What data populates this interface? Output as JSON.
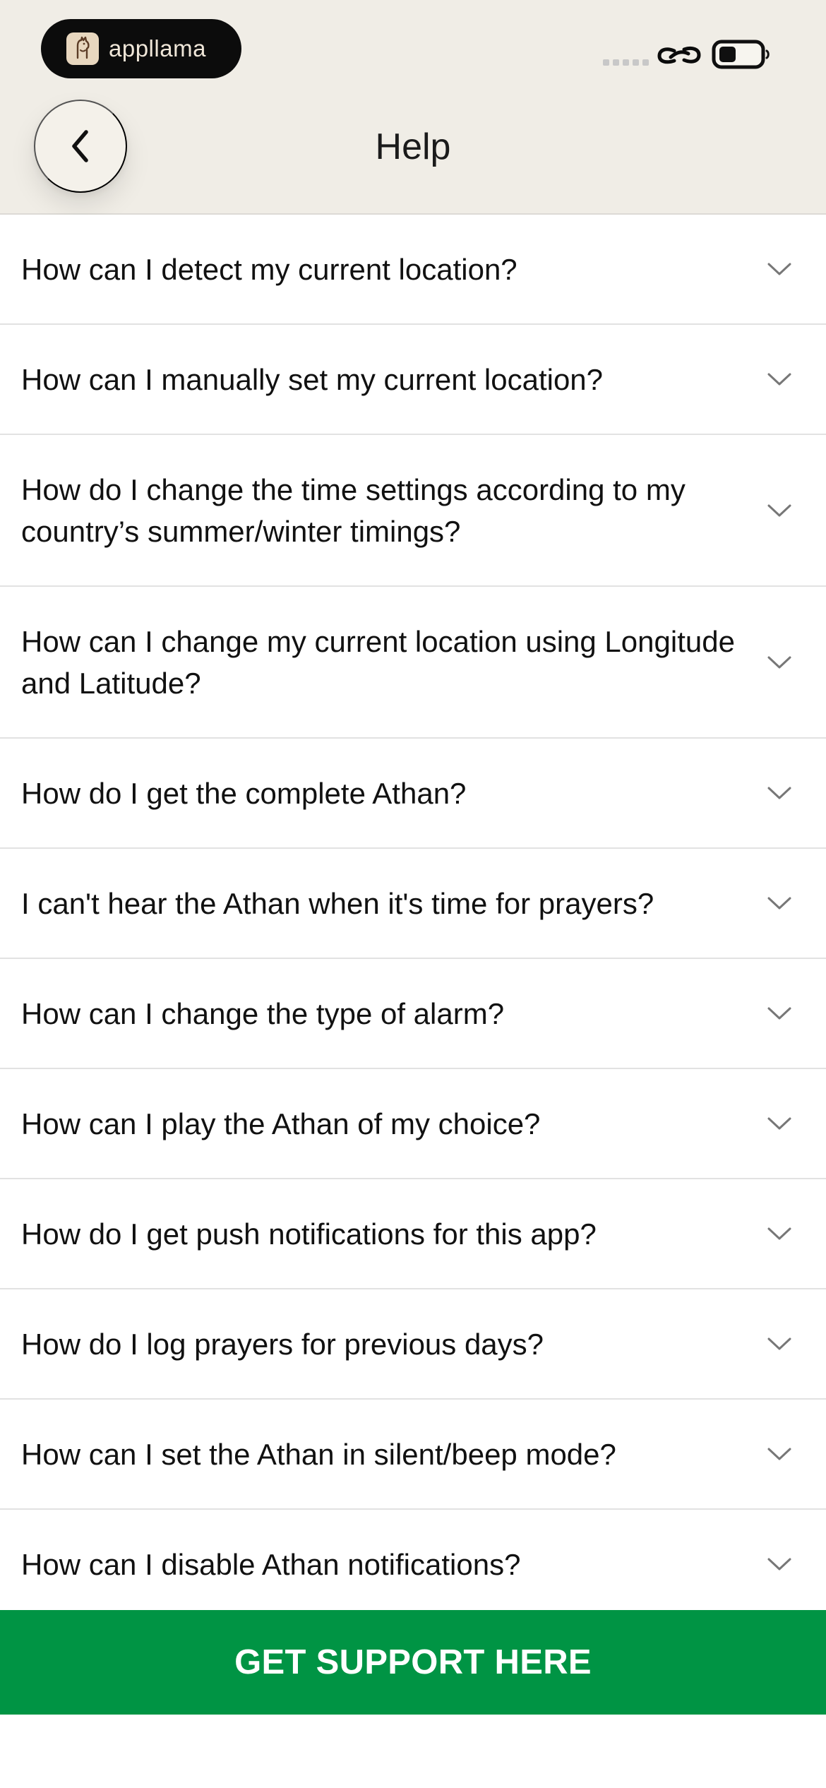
{
  "app": {
    "brand_name": "appllama",
    "title": "Help"
  },
  "status_bar": {
    "icons": [
      "signal-dots-icon",
      "link-icon",
      "battery-icon"
    ]
  },
  "faqs": [
    {
      "question": "How can I detect my current location?"
    },
    {
      "question": "How can I manually set my current location?"
    },
    {
      "question": "How do I change the time settings according to my country’s summer/winter timings?"
    },
    {
      "question": "How can I change my current location using Longitude and Latitude?"
    },
    {
      "question": "How do I get the complete Athan?"
    },
    {
      "question": "I can't hear the Athan when it's time for prayers?"
    },
    {
      "question": "How can I change the type of alarm?"
    },
    {
      "question": "How can I play the Athan of my choice?"
    },
    {
      "question": "How do I get push notifications for this app?"
    },
    {
      "question": "How do I log prayers for previous days?"
    },
    {
      "question": "How can I set the Athan in silent/beep mode?"
    },
    {
      "question": "How can I disable Athan notifications?"
    }
  ],
  "support": {
    "label": "GET SUPPORT HERE"
  },
  "colors": {
    "header_background": "#f0ede6",
    "accent_green": "#009444",
    "divider": "#e2e2e2"
  }
}
